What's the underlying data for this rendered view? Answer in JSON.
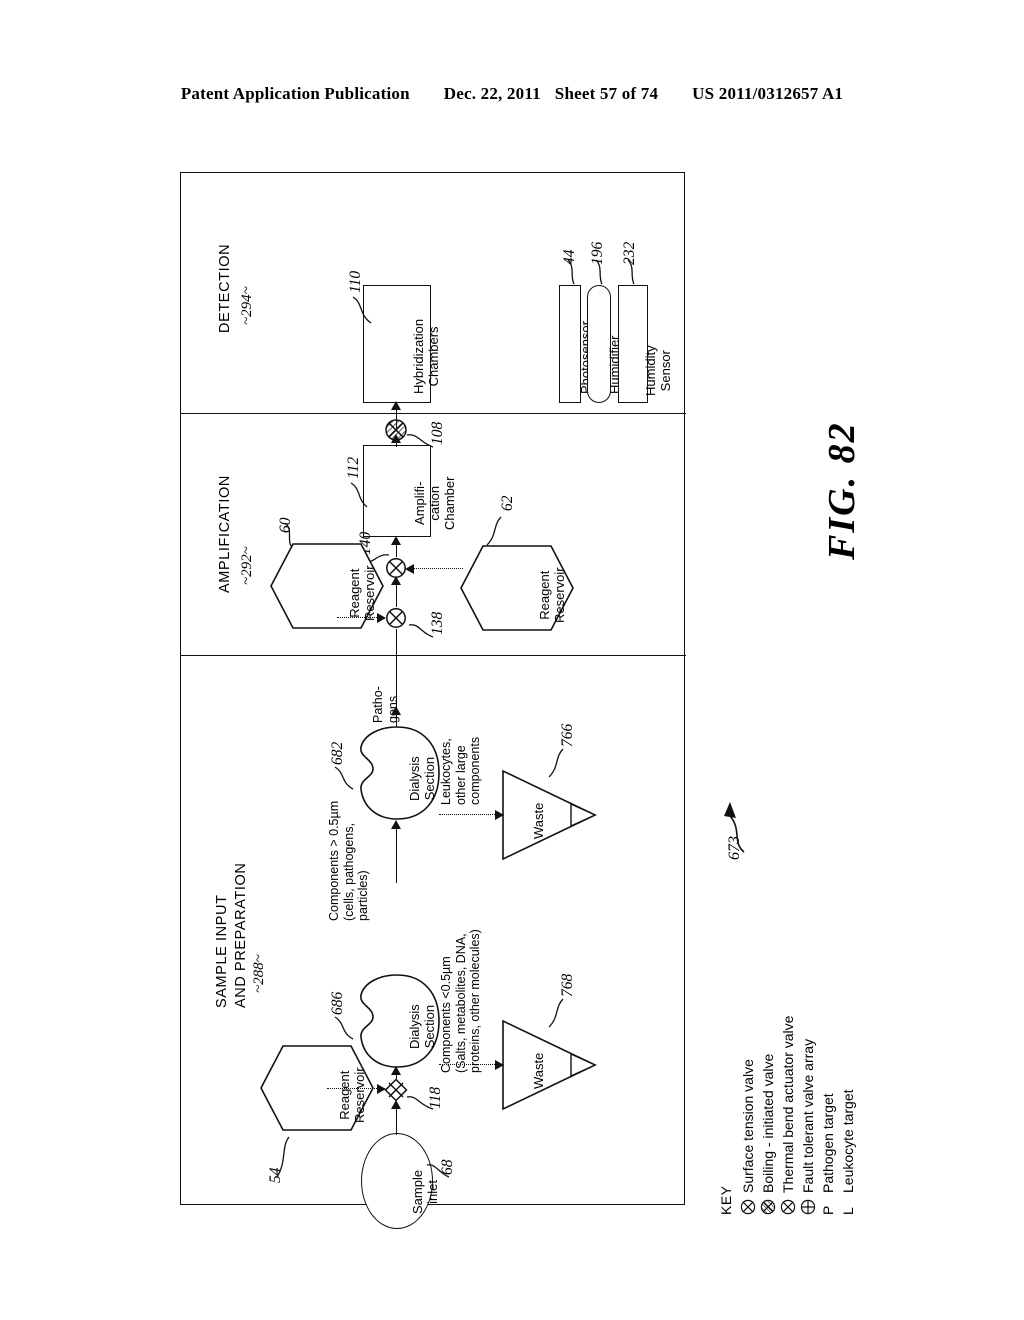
{
  "header": {
    "publication": "Patent Application Publication",
    "date": "Dec. 22, 2011",
    "sheet": "Sheet 57 of 74",
    "number": "US 2011/0312657 A1"
  },
  "figure": {
    "caption": "FIG. 82",
    "overall_ref": "673"
  },
  "sections": [
    {
      "id": "detection",
      "title": "DETECTION",
      "ref": "~294~"
    },
    {
      "id": "amplification",
      "title": "AMPLIFICATION",
      "ref": "~292~"
    },
    {
      "id": "sample",
      "title": "SAMPLE INPUT\nAND PREPARATION",
      "ref": "~288~"
    }
  ],
  "nodes": {
    "hybridization_chambers": {
      "label": "Hybridization\nChambers",
      "ref": "110",
      "shape": "rect"
    },
    "photosensor": {
      "label": "Photosensor",
      "ref": "44",
      "shape": "rect"
    },
    "humidifier": {
      "label": "Humidifier",
      "ref": "196",
      "shape": "pill"
    },
    "humidity_sensor": {
      "label": "Humidity\nSensor",
      "ref": "232",
      "shape": "rect"
    },
    "amplification_chamber": {
      "label": "Amplifi-\ncation\nChamber",
      "ref": "112",
      "shape": "rect"
    },
    "reagent_reservoir_60": {
      "label": "Reagent\nReservoir",
      "ref": "60",
      "shape": "hexagon"
    },
    "reagent_reservoir_62": {
      "label": "Reagent\nReservoir",
      "ref": "62",
      "shape": "hexagon"
    },
    "reagent_reservoir_54": {
      "label": "Reagent\nReservoir",
      "ref": "54",
      "shape": "hexagon"
    },
    "dialysis_section_682": {
      "label": "Dialysis\nSection",
      "ref": "682",
      "shape": "blob"
    },
    "dialysis_section_686": {
      "label": "Dialysis\nSection",
      "ref": "686",
      "shape": "blob"
    },
    "sample_inlet": {
      "label": "Sample\ninlet",
      "ref": "68",
      "shape": "ellipse"
    },
    "waste_766": {
      "label": "Waste",
      "ref": "766",
      "shape": "triangle"
    },
    "waste_768": {
      "label": "Waste",
      "ref": "768",
      "shape": "triangle"
    }
  },
  "valves": [
    {
      "ref": "108",
      "type": "boiling-initiated-valve"
    },
    {
      "ref": "140",
      "type": "surface-tension-valve"
    },
    {
      "ref": "138",
      "type": "surface-tension-valve"
    },
    {
      "ref": "118",
      "type": "fault-tolerant-valve-array"
    }
  ],
  "annotations": {
    "pathogens": "Patho-\ngens",
    "large_components": "Components > 0.5µm\n(cells, pathogens,\nparticles)",
    "leukocytes_out": "Leukocytes,\nother large\ncomponents",
    "small_components": "Components <0.5µm\n(Salts, metabolites, DNA,\nproteins, other molecules)"
  },
  "key": {
    "title": "KEY",
    "items": [
      {
        "glyph": "circle-x-icon",
        "letter": "",
        "label": "Surface tension valve"
      },
      {
        "glyph": "circle-x-hatched-icon",
        "letter": "",
        "label": "Boiling - initiated valve"
      },
      {
        "glyph": "circle-x-icon",
        "letter": "",
        "label": "Thermal bend actuator valve"
      },
      {
        "glyph": "circle-plus-icon",
        "letter": "",
        "label": "Fault tolerant valve array"
      },
      {
        "glyph": "",
        "letter": "P",
        "label": "Pathogen target"
      },
      {
        "glyph": "",
        "letter": "L",
        "label": "Leukocyte target"
      }
    ]
  },
  "colors": {
    "ink": "#111111",
    "paper": "#ffffff"
  }
}
